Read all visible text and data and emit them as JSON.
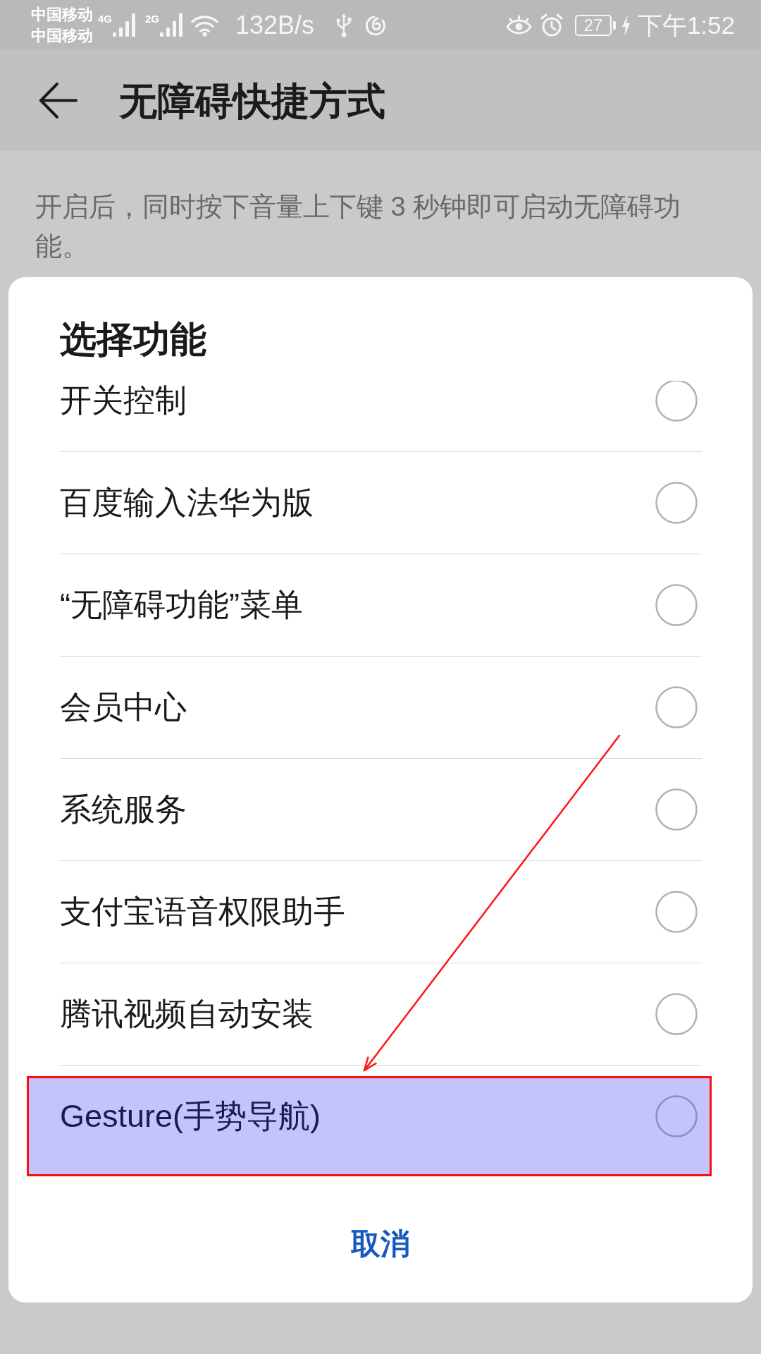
{
  "status_bar": {
    "carriers": [
      "中国移动",
      "中国移动"
    ],
    "signals": [
      {
        "label": "4G"
      },
      {
        "label": "2G"
      }
    ],
    "network_speed": "132B/s",
    "battery_percent": "27",
    "charging": true,
    "time": "下午1:52"
  },
  "app_bar": {
    "title": "无障碍快捷方式"
  },
  "description": "开启后，同时按下音量上下键 3 秒钟即可启动无障碍功能。",
  "dialog": {
    "title": "选择功能",
    "items": [
      {
        "label": "开关控制",
        "selected": false,
        "highlighted": false
      },
      {
        "label": "百度输入法华为版",
        "selected": false,
        "highlighted": false
      },
      {
        "label": "“无障碍功能”菜单",
        "selected": false,
        "highlighted": false
      },
      {
        "label": "会员中心",
        "selected": false,
        "highlighted": false
      },
      {
        "label": "系统服务",
        "selected": false,
        "highlighted": false
      },
      {
        "label": "支付宝语音权限助手",
        "selected": false,
        "highlighted": false
      },
      {
        "label": "腾讯视频自动安装",
        "selected": false,
        "highlighted": false
      },
      {
        "label": "Gesture(手势导航)",
        "selected": false,
        "highlighted": true
      }
    ],
    "cancel_button": "取消"
  }
}
